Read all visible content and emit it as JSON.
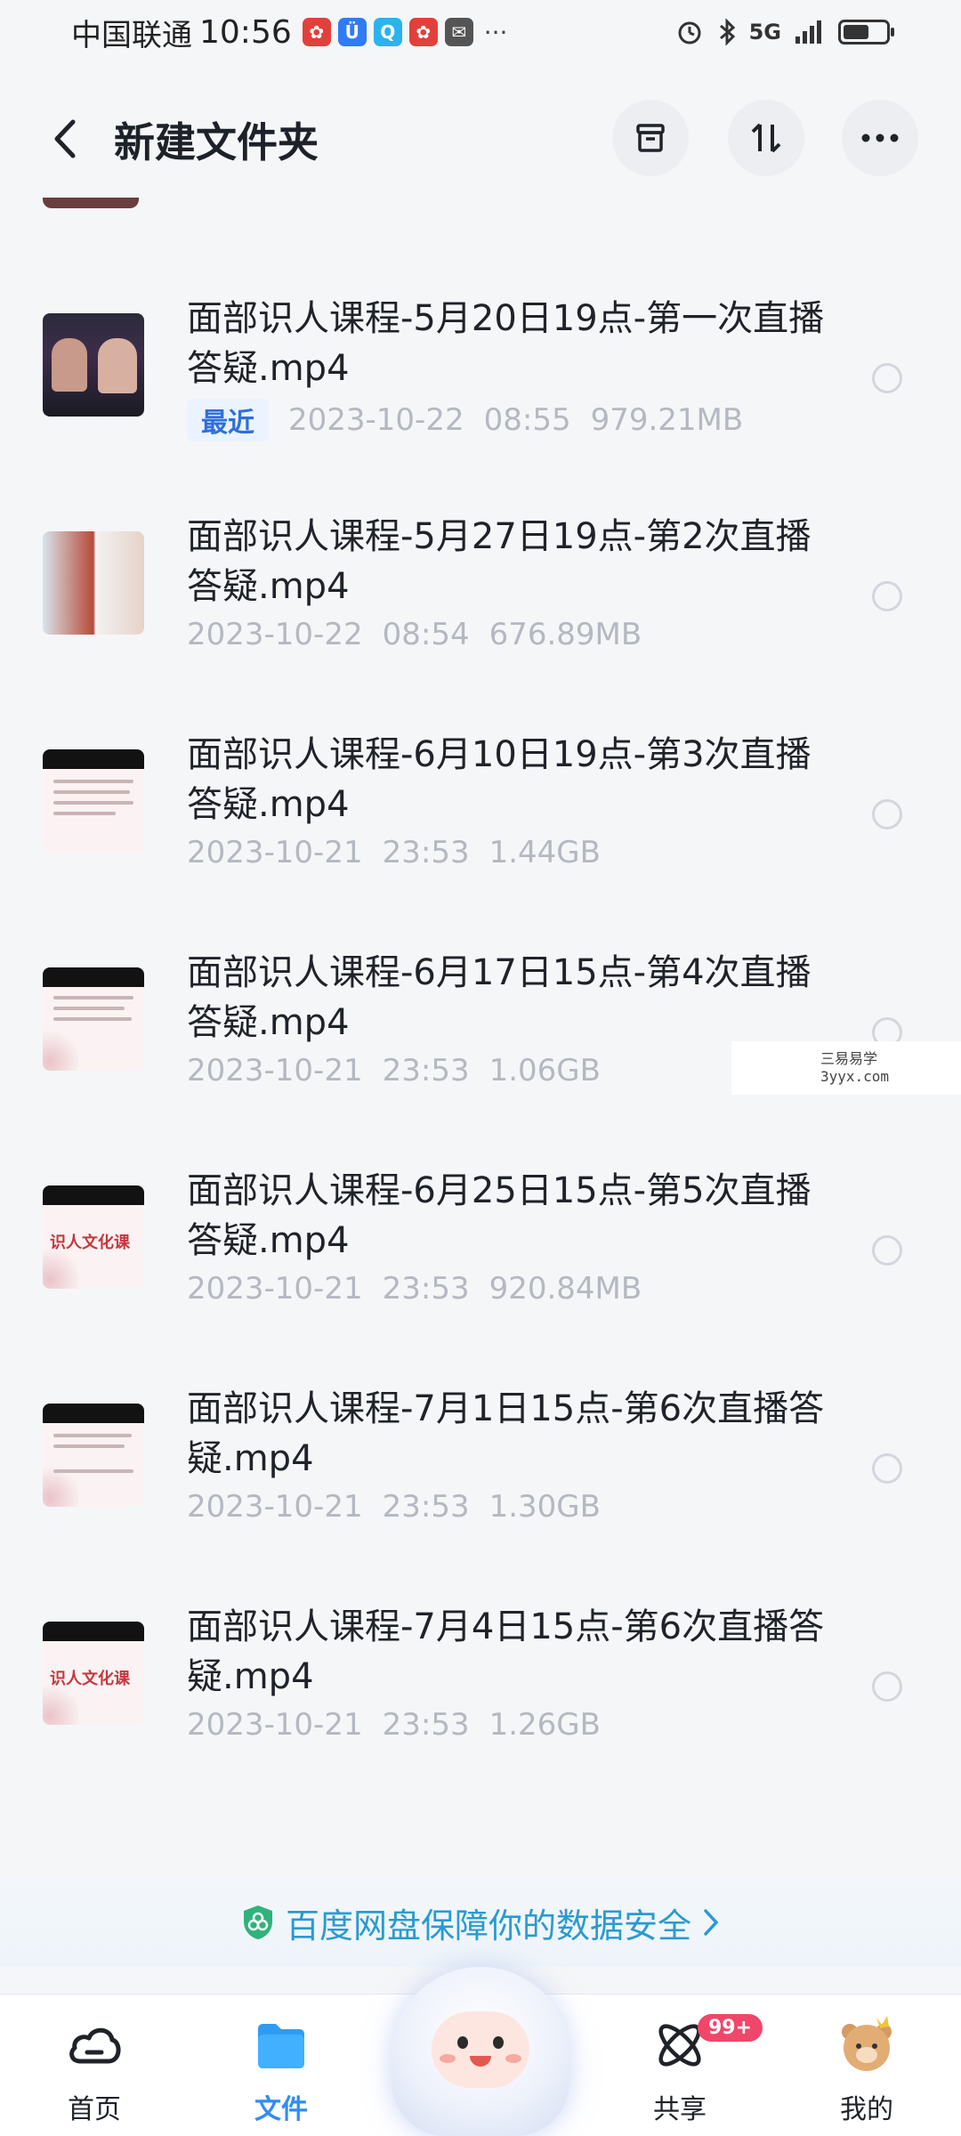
{
  "status_bar": {
    "carrier": "中国联通",
    "time": "10:56",
    "network": "5G"
  },
  "header": {
    "title": "新建文件夹"
  },
  "files": [
    {
      "name": "面部识人课程-5月20日19点-第一次直播答疑.mp4",
      "badge": "最近",
      "date": "2023-10-22",
      "time": "08:55",
      "size": "979.21MB"
    },
    {
      "name": "面部识人课程-5月27日19点-第2次直播答疑.mp4",
      "date": "2023-10-22",
      "time": "08:54",
      "size": "676.89MB"
    },
    {
      "name": "面部识人课程-6月10日19点-第3次直播答疑.mp4",
      "date": "2023-10-21",
      "time": "23:53",
      "size": "1.44GB"
    },
    {
      "name": "面部识人课程-6月17日15点-第4次直播答疑.mp4",
      "date": "2023-10-21",
      "time": "23:53",
      "size": "1.06GB"
    },
    {
      "name": "面部识人课程-6月25日15点-第5次直播答疑.mp4",
      "date": "2023-10-21",
      "time": "23:53",
      "size": "920.84MB"
    },
    {
      "name": "面部识人课程-7月1日15点-第6次直播答疑.mp4",
      "date": "2023-10-21",
      "time": "23:53",
      "size": "1.30GB"
    },
    {
      "name": "面部识人课程-7月4日15点-第6次直播答疑.mp4",
      "date": "2023-10-21",
      "time": "23:53",
      "size": "1.26GB"
    }
  ],
  "thumb_text": {
    "cover": "识人文化课"
  },
  "watermark": {
    "line1": "三易易学",
    "line2": "3yyx.com"
  },
  "security_banner": {
    "text": "百度网盘保障你的数据安全"
  },
  "bottom_nav": {
    "items": [
      {
        "label": "首页"
      },
      {
        "label": "文件"
      },
      {
        "label": "共享",
        "badge": "99+"
      },
      {
        "label": "我的"
      }
    ]
  },
  "colors": {
    "accent": "#2f8df3",
    "badge": "#f0466a",
    "security": "#2a9ad0"
  }
}
